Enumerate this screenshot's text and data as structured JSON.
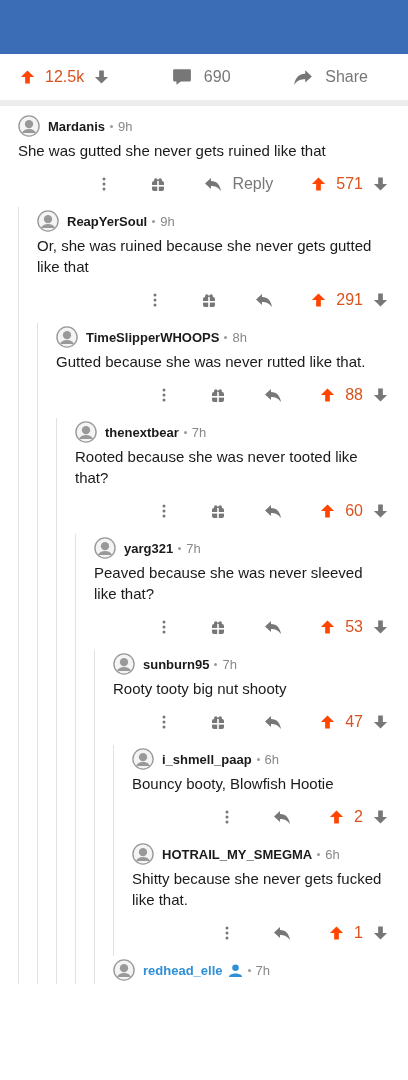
{
  "post_bar": {
    "votes": "12.5k",
    "upvoted": true,
    "comments": "690",
    "share": "Share"
  },
  "comments": [
    {
      "author": "Mardanis",
      "time": "9h",
      "is_op": false,
      "text": "She was gutted she never gets ruined like that",
      "award": true,
      "reply_label": "Reply",
      "score": "571",
      "upvoted": true,
      "children": [
        {
          "author": "ReapYerSoul",
          "time": "9h",
          "is_op": false,
          "text": "Or, she was ruined because she never gets gutted like that",
          "award": true,
          "score": "291",
          "upvoted": true,
          "children": [
            {
              "author": "TimeSlipperWHOOPS",
              "time": "8h",
              "is_op": false,
              "text": "Gutted because she was never rutted like that.",
              "award": true,
              "score": "88",
              "upvoted": true,
              "children": [
                {
                  "author": "thenextbear",
                  "time": "7h",
                  "is_op": false,
                  "text": "Rooted because she was never tooted like that?",
                  "award": true,
                  "score": "60",
                  "upvoted": true,
                  "children": [
                    {
                      "author": "yarg321",
                      "time": "7h",
                      "is_op": false,
                      "text": "Peaved because she was never sleeved like that?",
                      "award": true,
                      "score": "53",
                      "upvoted": true,
                      "children": [
                        {
                          "author": "sunburn95",
                          "time": "7h",
                          "is_op": false,
                          "text": "Rooty tooty big nut shooty",
                          "award": true,
                          "score": "47",
                          "upvoted": true,
                          "children": [
                            {
                              "author": "i_shmell_paap",
                              "time": "6h",
                              "is_op": false,
                              "text": "Bouncy booty, Blowfish Hootie",
                              "award": false,
                              "score": "2",
                              "upvoted": true
                            },
                            {
                              "author": "HOTRAIL_MY_SMEGMA",
                              "time": "6h",
                              "is_op": false,
                              "text": "Shitty because she never gets fucked like that.",
                              "award": false,
                              "score": "1",
                              "upvoted": true
                            }
                          ]
                        },
                        {
                          "author": "redhead_elle",
                          "time": "7h",
                          "is_op": true
                        }
                      ]
                    }
                  ]
                }
              ]
            }
          ]
        }
      ]
    }
  ]
}
